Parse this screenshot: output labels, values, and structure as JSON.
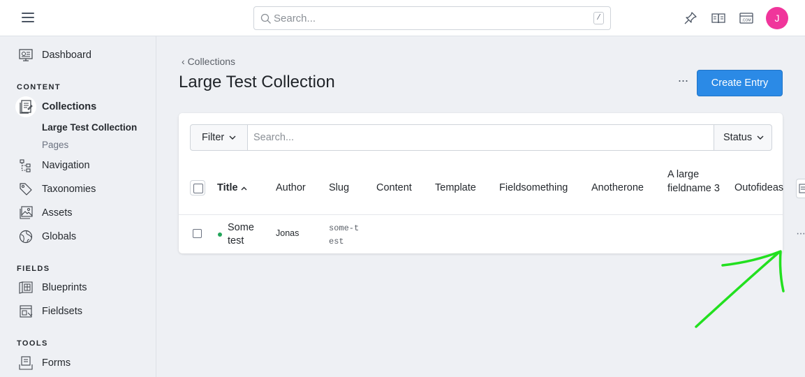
{
  "topbar": {
    "search_placeholder": "Search...",
    "search_shortcut": "/",
    "icons": [
      "pin-icon",
      "book-icon",
      "site-icon"
    ],
    "avatar_initial": "J",
    "avatar_color": "#f0359b"
  },
  "sidebar": {
    "dashboard": "Dashboard",
    "content_heading": "CONTENT",
    "collections": "Collections",
    "collections_children": [
      "Large Test Collection",
      "Pages"
    ],
    "navigation": "Navigation",
    "taxonomies": "Taxonomies",
    "assets": "Assets",
    "globals": "Globals",
    "fields_heading": "FIELDS",
    "blueprints": "Blueprints",
    "fieldsets": "Fieldsets",
    "tools_heading": "TOOLS",
    "forms": "Forms"
  },
  "main": {
    "breadcrumb": "Collections",
    "title": "Large Test Collection",
    "more_label": "···",
    "create_label": "Create Entry",
    "accent_color": "#2b8ae6"
  },
  "listing": {
    "filter_label": "Filter",
    "search_placeholder": "Search...",
    "status_label": "Status",
    "columns": [
      "Title",
      "Author",
      "Slug",
      "Content",
      "Template",
      "Fieldsomething",
      "Anotherone",
      "A large fieldname 3",
      "Outofideas"
    ],
    "sort_column": "Title",
    "rows": [
      {
        "status_color": "#23a55a",
        "title": "Some test",
        "author": "Jonas",
        "slug": "some-test"
      }
    ],
    "row_actions_label": "···"
  },
  "annotation": {
    "color": "#22e01f"
  }
}
